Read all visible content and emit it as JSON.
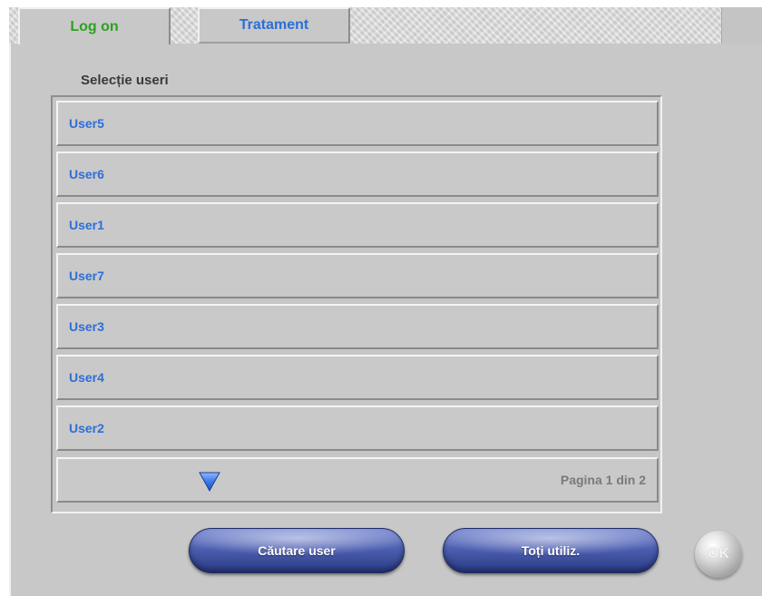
{
  "tabs": {
    "logon": "Log on",
    "tratament": "Tratament"
  },
  "section": {
    "title": "Selecție useri"
  },
  "users": [
    "User5",
    "User6",
    "User1",
    "User7",
    "User3",
    "User4",
    "User2"
  ],
  "pager": {
    "text": "Pagina 1 din 2",
    "icon": "triangle-down-icon"
  },
  "buttons": {
    "search": "Căutare user",
    "all": "Toți utiliz.",
    "ok": "OK"
  },
  "colors": {
    "active_tab_text": "#2ea11f",
    "link_blue": "#2e6ed8",
    "panel_gray": "#c8c8c8",
    "button_blue": "#4d5fb0"
  }
}
